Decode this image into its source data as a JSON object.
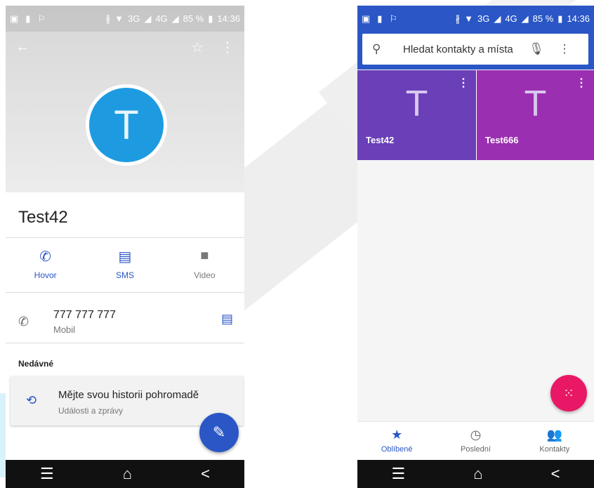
{
  "status_bar": {
    "left_icons": [
      "image-icon",
      "sim-icon",
      "flag-icon"
    ],
    "network": "3G",
    "network2": "4G",
    "battery": "85 %",
    "time": "14:36"
  },
  "contact_detail": {
    "avatar_letter": "T",
    "name": "Test42",
    "actions": [
      {
        "label": "Hovor",
        "icon": "phone-icon"
      },
      {
        "label": "SMS",
        "icon": "message-icon"
      },
      {
        "label": "Video",
        "icon": "video-icon"
      }
    ],
    "phone_number": "777 777 777",
    "phone_type": "Mobil",
    "recent_heading": "Nedávné",
    "history_card": {
      "title": "Mějte svou historii pohromadě",
      "subtitle": "Události a zprávy"
    }
  },
  "favorites": {
    "search_placeholder": "Hledat kontakty a místa",
    "tiles": [
      {
        "letter": "T",
        "name": "Test42",
        "color": "#6a3fb8"
      },
      {
        "letter": "T",
        "name": "Test666",
        "color": "#9b2fb1"
      }
    ],
    "bottom_nav": [
      {
        "label": "Oblíbené",
        "icon": "star-icon",
        "active": true
      },
      {
        "label": "Poslední",
        "icon": "clock-icon",
        "active": false
      },
      {
        "label": "Kontakty",
        "icon": "people-icon",
        "active": false
      }
    ]
  },
  "colors": {
    "accent": "#2a56c6",
    "avatar": "#1e9be0",
    "dial_fab": "#e81866"
  }
}
